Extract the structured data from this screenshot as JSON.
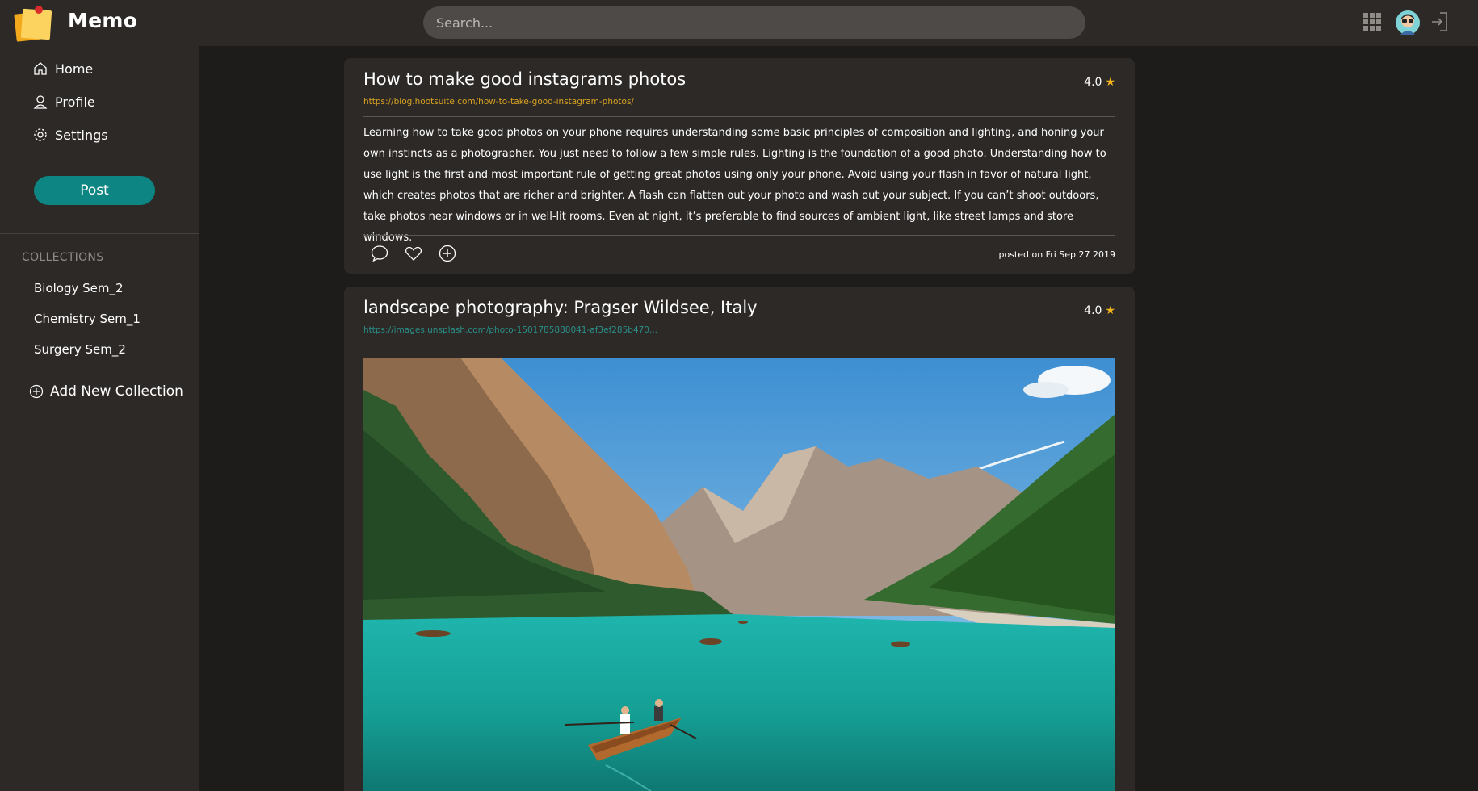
{
  "header": {
    "brand": "Memo",
    "search_placeholder": "Search..."
  },
  "sidebar": {
    "nav": [
      {
        "label": "Home",
        "icon": "home-icon"
      },
      {
        "label": "Profile",
        "icon": "user-icon"
      },
      {
        "label": "Settings",
        "icon": "gear-icon"
      }
    ],
    "post_label": "Post",
    "collections_heading": "COLLECTIONS",
    "collections": [
      "Biology Sem_2",
      "Chemistry Sem_1",
      "Surgery Sem_2"
    ],
    "add_collection_label": "Add New Collection"
  },
  "posts": [
    {
      "title": "How to make good instagrams photos",
      "rating": "4.0",
      "link": "https://blog.hootsuite.com/how-to-take-good-instagram-photos/",
      "body": "Learning how to take good photos on your phone requires understanding some basic principles of composition and lighting, and honing your own instincts as a photographer. You just need to follow a few simple rules. Lighting is the foundation of a good photo. Understanding how to use light is the first and most important rule of getting great photos using only your phone. Avoid using your flash in favor of natural light, which creates photos that are richer and brighter. A flash can flatten out your photo and wash out your subject. If you can’t shoot outdoors, take photos near windows or in well-lit rooms. Even at night, it’s preferable to find sources of ambient light, like street lamps and store windows.",
      "posted": "posted on Fri Sep 27 2019"
    },
    {
      "title": "landscape photography: Pragser Wildsee, Italy",
      "rating": "4.0",
      "link": "https://images.unsplash.com/photo-1501785888041-af3ef285b470..."
    }
  ],
  "colors": {
    "accent": "#0d8582",
    "star": "#f2b51c",
    "link_orange": "#d9a321",
    "link_teal": "#2a8f88",
    "panel": "#2c2927",
    "background": "#1e1c1b"
  }
}
